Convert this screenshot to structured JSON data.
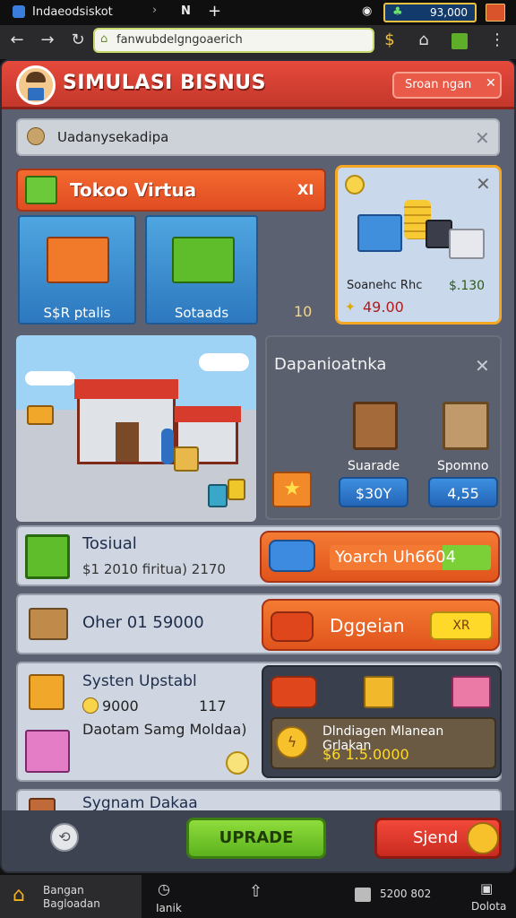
{
  "status_bar": {
    "tab_title": "Indaeodsiskot",
    "balance": "93,000",
    "battery_icon": "battery-icon"
  },
  "browser": {
    "url": "fanwubdelgngoaerich"
  },
  "header": {
    "title": "SIMULASI BISNUS",
    "button_label": "Sroan ngan"
  },
  "notice": {
    "text": "Uadanysekadipa"
  },
  "shop": {
    "title": "Tokoo Virtua",
    "close": "XI",
    "tiles": [
      {
        "label": "S$R ptalis"
      },
      {
        "label": "Sotaads"
      }
    ],
    "count": "10"
  },
  "product_card": {
    "name": "Soanehc Rhc",
    "price": "$.130",
    "total": "49.00"
  },
  "dept": {
    "title": "Dapanioatnka",
    "items": [
      {
        "label": "Suarade",
        "value": "$30Y"
      },
      {
        "label": "Spomno",
        "value": "4,55"
      }
    ]
  },
  "row1": {
    "title": "Tosiual",
    "details": "$1 2010  firitua)  2170",
    "button": "Yoarch Uh6604"
  },
  "row2": {
    "title": "Oher  01  59000",
    "button": "Dggeian",
    "badge": "XR"
  },
  "upgrade": {
    "title": "Systen Upstabl",
    "coins": "9000",
    "count": "117",
    "sub": "Daotam  Samg  Moldaa)",
    "card_title": "Dlndiagen Mlanean Grlakan",
    "card_value": "$6  1.5.0000"
  },
  "row4": {
    "title": "Sygnam Dakaa"
  },
  "actions": {
    "upgrade": "UPRADE",
    "spend": "Sjend"
  },
  "bottom_nav": [
    {
      "label": "Bangan Bagloadan",
      "icon": "home-icon"
    },
    {
      "label": "Ianik",
      "icon": "clock-icon"
    },
    {
      "label": "",
      "icon": "upload-icon"
    },
    {
      "label": "5200  802",
      "icon": "box-icon"
    },
    {
      "label": "Dolota",
      "icon": "trash-icon"
    }
  ]
}
